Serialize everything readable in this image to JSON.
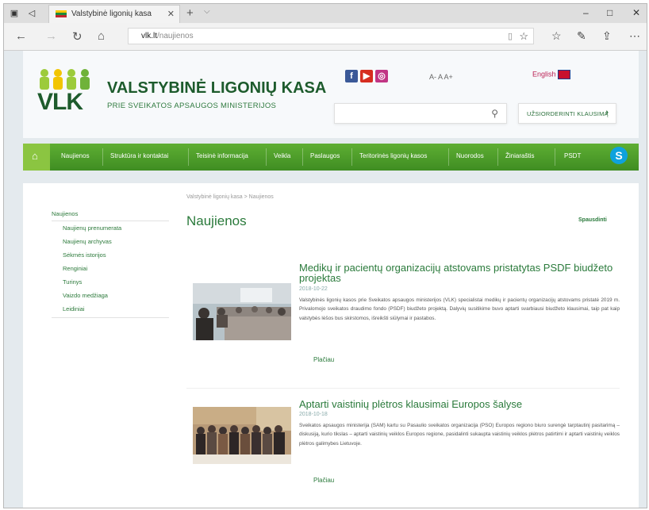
{
  "browser": {
    "tab_title": "Valstybinė ligonių kasa",
    "url_host": "vlk.lt",
    "url_path": "/naujienos"
  },
  "header": {
    "logo_text": "VLK",
    "site_name": "VALSTYBINĖ LIGONIŲ KASA",
    "site_subtitle": "PRIE SVEIKATOS APSAUGOS MINISTERIJOS",
    "text_size_controls": "A- A A+",
    "language_label": "English",
    "search_placeholder": "",
    "cta_label": "UŽSIORDERINTI KLAUSIMĄ"
  },
  "menu": {
    "items": [
      "Naujienos",
      "Struktūra ir kontaktai",
      "Teisinė informacija",
      "Veikla",
      "Paslaugos",
      "Teritorinės ligonių kasos",
      "Nuorodos",
      "Žiniaraštis",
      "PSDT"
    ]
  },
  "sidebar": {
    "items": [
      "Naujienos",
      "Naujienų prenumerata",
      "Naujienų archyvas",
      "Sėkmės istorijos",
      "Renginiai",
      "Turinys",
      "Vaizdo medžiaga",
      "Leidiniai"
    ]
  },
  "breadcrumb": "Valstybinė ligonių kasa > Naujienos",
  "page_title": "Naujienos",
  "print_label": "Spausdinti",
  "articles": [
    {
      "title": "Medikų ir pacientų organizacijų atstovams pristatytas PSDF biudžeto projektas",
      "date": "2018-10-22",
      "body": "Valstybinės ligonių kasos prie Sveikatos apsaugos ministerijos (VLK) specialistai medikų ir pacientų organizacijų atstovams pristatė 2019 m. Privalomojo sveikatos draudimo fondo (PSDF) biudžeto projektą. Dalyvių susitikime buvo aptarti svarbiausi biudžeto klausimai, taip pat kaip valstybės lėšos bus skirstomos, išreikšti siūlymai ir pastabos.",
      "more_label": "Plačiau"
    },
    {
      "title": "Aptarti vaistinių plėtros klausimai Europos šalyse",
      "date": "2018-10-18",
      "body": "Sveikatos apsaugos ministerija (SAM) kartu su Pasaulio sveikatos organizacija (PSO) Europos regiono biuro surengė tarptautinį pasitarimą – diskusiją, kurio tikslas – aptarti vaistinių veiklos Europos regione, pasidalinti sukaupta vaistinių veiklos plėtros patirtimi ir aptarti vaistinių veiklos plėtros galimybes Lietuvoje.",
      "more_label": "Plačiau"
    }
  ],
  "colors": {
    "brand_green": "#2a7a3b",
    "menu_green": "#4c9a28",
    "home_green": "#8bc541",
    "skype_blue": "#0fa2dd"
  },
  "icons": {
    "social": [
      "facebook-icon",
      "youtube-icon",
      "instagram-icon"
    ],
    "skype": "S"
  }
}
